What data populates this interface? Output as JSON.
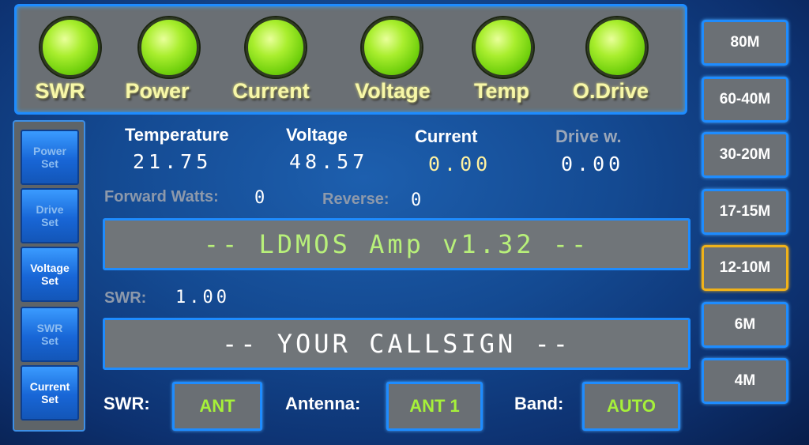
{
  "indicators": [
    {
      "label": "SWR",
      "icon": "led-indicator",
      "color": "#8be41c"
    },
    {
      "label": "Power",
      "icon": "led-indicator",
      "color": "#8be41c"
    },
    {
      "label": "Current",
      "icon": "led-indicator",
      "color": "#8be41c"
    },
    {
      "label": "Voltage",
      "icon": "led-indicator",
      "color": "#8be41c"
    },
    {
      "label": "Temp",
      "icon": "led-indicator",
      "color": "#8be41c"
    },
    {
      "label": "O.Drive",
      "icon": "led-indicator",
      "color": "#8be41c"
    }
  ],
  "sidebar": {
    "items": [
      {
        "label": "Power\nSet",
        "state": "dim"
      },
      {
        "label": "Drive\nSet",
        "state": "dim"
      },
      {
        "label": "Voltage\nSet",
        "state": "active"
      },
      {
        "label": "SWR\nSet",
        "state": "dim"
      },
      {
        "label": "Current\nSet",
        "state": "active"
      }
    ]
  },
  "bands": {
    "items": [
      "80M",
      "60-40M",
      "30-20M",
      "17-15M",
      "12-10M",
      "6M",
      "4M"
    ],
    "selected": "12-10M",
    "selected_color": "#f0b21a"
  },
  "stats": {
    "temperature_label": "Temperature",
    "temperature_value": "21.75",
    "voltage_label": "Voltage",
    "voltage_value": "48.57",
    "current_label": "Current",
    "current_value": "0.00",
    "drive_label": "Drive w.",
    "drive_value": "0.00"
  },
  "readouts": {
    "forward_label": "Forward Watts:",
    "forward_value": "0",
    "reverse_label": "Reverse:",
    "reverse_value": "0",
    "swr_label": "SWR:",
    "swr_value": "1.00"
  },
  "displays": {
    "title": "-- LDMOS Amp v1.32 --",
    "title_color": "#b8f07a",
    "callsign": "-- YOUR CALLSIGN --",
    "callsign_color": "#ffffff"
  },
  "bottom": {
    "swr_label": "SWR:",
    "swr_button": "ANT",
    "antenna_label": "Antenna:",
    "antenna_button": "ANT 1",
    "band_label": "Band:",
    "band_button": "AUTO"
  },
  "colors": {
    "accent": "#1e8cff",
    "led_green": "#8be41c",
    "button_text_green": "#a6f03a",
    "label_yellow": "#f7f7a8"
  }
}
